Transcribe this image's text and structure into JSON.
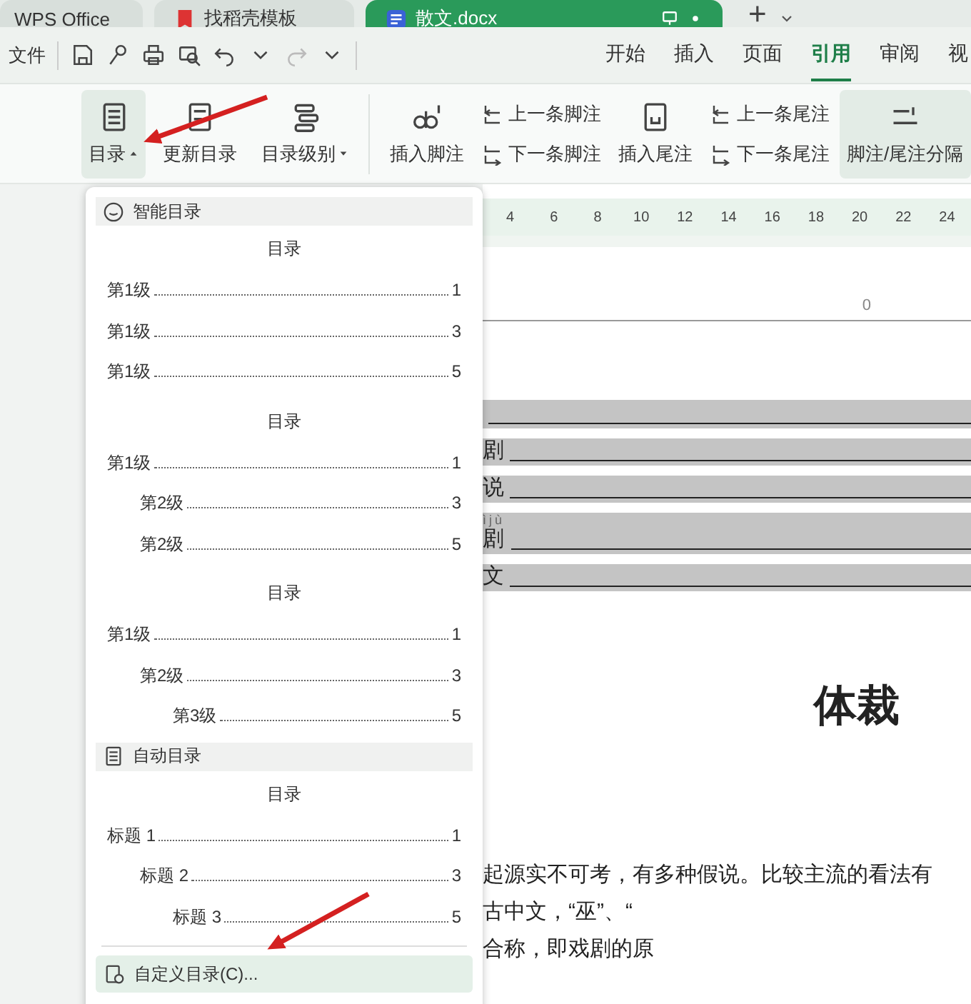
{
  "title_tabs": [
    {
      "label": "WPS Office",
      "kind": "home",
      "selected": false
    },
    {
      "label": "找稻壳模板",
      "kind": "template",
      "selected": false
    },
    {
      "label": "散文.docx",
      "kind": "doc",
      "selected": true
    }
  ],
  "new_tab": "+",
  "quick_bar": {
    "file_menu": "文件"
  },
  "menu_tabs": [
    {
      "label": "开始",
      "selected": false
    },
    {
      "label": "插入",
      "selected": false
    },
    {
      "label": "页面",
      "selected": false
    },
    {
      "label": "引用",
      "selected": true
    },
    {
      "label": "审阅",
      "selected": false
    },
    {
      "label": "视",
      "selected": false
    }
  ],
  "ribbon": [
    {
      "kind": "menu",
      "label": "目录",
      "expanded": true,
      "pressed": true
    },
    {
      "kind": "large",
      "label": "更新目录",
      "pressed": false
    },
    {
      "kind": "menu",
      "label": "目录级别",
      "expanded": false,
      "pressed": false
    },
    {
      "kind": "divider"
    },
    {
      "kind": "large",
      "label": "插入脚注",
      "pressed": false
    },
    {
      "kind": "stack",
      "items": [
        {
          "label": "上一条脚注"
        },
        {
          "label": "下一条脚注"
        }
      ]
    },
    {
      "kind": "large",
      "label": "插入尾注",
      "pressed": false
    },
    {
      "kind": "stack",
      "items": [
        {
          "label": "上一条尾注"
        },
        {
          "label": "下一条尾注"
        }
      ]
    },
    {
      "kind": "large",
      "label": "脚注/尾注分隔",
      "pressed": true
    }
  ],
  "dropdown": {
    "sections": [
      {
        "title": "智能目录",
        "previews": [
          {
            "heading": "目录",
            "entries": [
              {
                "label": "第1级",
                "page": "1"
              },
              {
                "label": "第1级",
                "page": "3"
              },
              {
                "label": "第1级",
                "page": "5"
              }
            ]
          },
          {
            "heading": "目录",
            "entries": [
              {
                "label": "第1级",
                "page": "1",
                "children": [
                  {
                    "label": "第2级",
                    "page": "3"
                  },
                  {
                    "label": "第2级",
                    "page": "5"
                  }
                ]
              }
            ]
          },
          {
            "heading": "目录",
            "entries": [
              {
                "label": "第1级",
                "page": "1",
                "children": [
                  {
                    "label": "第2级",
                    "page": "3",
                    "children": [
                      {
                        "label": "第3级",
                        "page": "5"
                      }
                    ]
                  }
                ]
              }
            ]
          }
        ]
      },
      {
        "title": "自动目录",
        "previews": [
          {
            "heading": "目录",
            "entries": [
              {
                "label": "标题 1",
                "page": "1",
                "children": [
                  {
                    "label": "标题 2",
                    "page": "3",
                    "children": [
                      {
                        "label": "标题 3",
                        "page": "5"
                      }
                    ]
                  }
                ]
              }
            ]
          }
        ]
      }
    ],
    "custom_button": "自定义目录(C)..."
  },
  "document": {
    "ruler": [
      "4",
      "6",
      "8",
      "10",
      "12",
      "14",
      "16",
      "18",
      "20",
      "22",
      "24"
    ],
    "header_number": "0",
    "toc_lines": [
      {
        "kind": "blank"
      },
      {
        "kind": "text",
        "text": "剧"
      },
      {
        "kind": "text",
        "text": "说"
      },
      {
        "kind": "text",
        "pinyin": "ìjù",
        "text": "剧"
      },
      {
        "kind": "text",
        "text": "文"
      }
    ],
    "title": "体裁",
    "paragraph_lines": [
      "起源实不可考，有多种假说。比较主流的看法有",
      "古中文，“巫”、“",
      "合称，即戏剧的原"
    ]
  }
}
